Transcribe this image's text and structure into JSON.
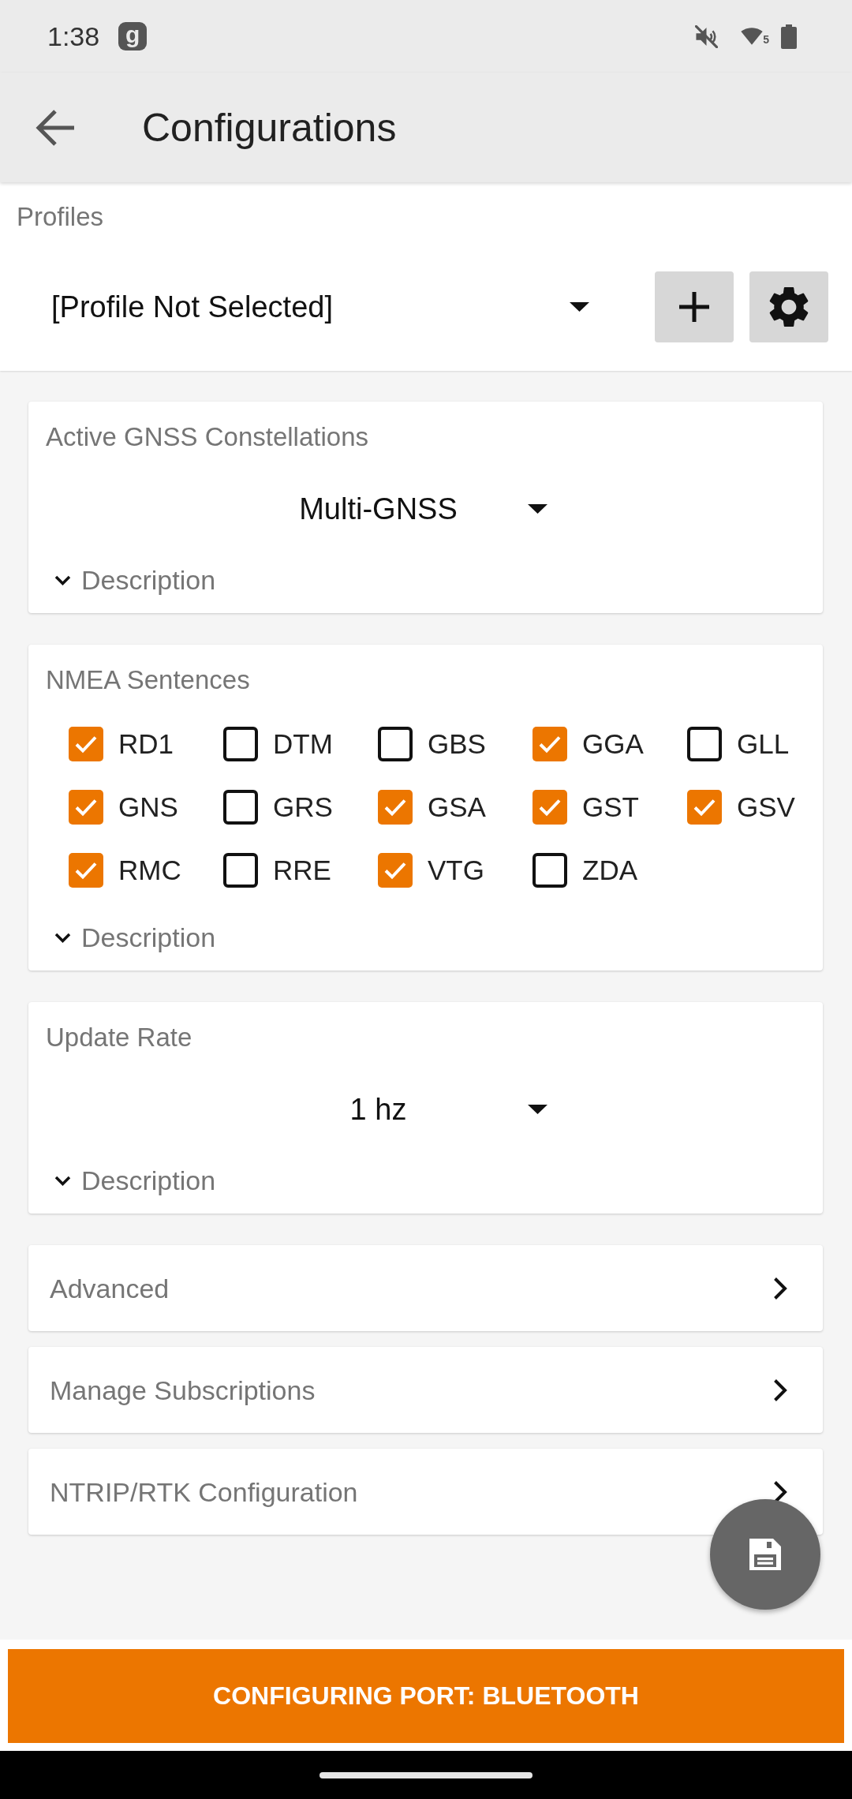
{
  "status_bar": {
    "time": "1:38",
    "notification_app": "g",
    "wifi_band": "5"
  },
  "app_bar": {
    "title": "Configurations"
  },
  "profiles": {
    "label": "Profiles",
    "value": "[Profile Not Selected]"
  },
  "sections": [
    {
      "kind": "spinner",
      "title": "Active GNSS Constellations",
      "value": "Multi-GNSS",
      "description": {
        "label": "Description",
        "expanded": false
      }
    },
    {
      "kind": "checkboxes",
      "title": "NMEA Sentences",
      "options": [
        {
          "label": "RD1",
          "checked": true
        },
        {
          "label": "DTM",
          "checked": false
        },
        {
          "label": "GBS",
          "checked": false
        },
        {
          "label": "GGA",
          "checked": true
        },
        {
          "label": "GLL",
          "checked": false
        },
        {
          "label": "GNS",
          "checked": true
        },
        {
          "label": "GRS",
          "checked": false
        },
        {
          "label": "GSA",
          "checked": true
        },
        {
          "label": "GST",
          "checked": true
        },
        {
          "label": "GSV",
          "checked": true
        },
        {
          "label": "RMC",
          "checked": true
        },
        {
          "label": "RRE",
          "checked": false
        },
        {
          "label": "VTG",
          "checked": true
        },
        {
          "label": "ZDA",
          "checked": false
        }
      ],
      "description": {
        "label": "Description",
        "expanded": false
      }
    },
    {
      "kind": "spinner",
      "title": "Update Rate",
      "value": "1 hz",
      "description": {
        "label": "Description",
        "expanded": false
      }
    }
  ],
  "links": [
    {
      "label": "Advanced"
    },
    {
      "label": "Manage Subscriptions"
    },
    {
      "label": "NTRIP/RTK Configuration"
    }
  ],
  "port_banner": {
    "label": "CONFIGURING PORT: BLUETOOTH"
  }
}
